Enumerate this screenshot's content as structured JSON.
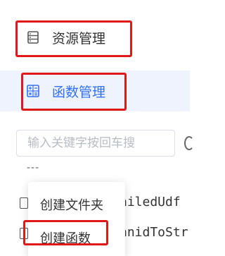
{
  "nav": {
    "resources": {
      "label": "资源管理",
      "icon": "list-doc-icon"
    },
    "functions": {
      "label": "函数管理",
      "icon": "function-calc-icon",
      "active": true
    }
  },
  "search": {
    "placeholder": "输入关键字按回车搜"
  },
  "tree": {
    "ellipsis": "---",
    "rows": [
      {
        "label": "ailedUdf"
      },
      {
        "label": "anidToStr"
      }
    ]
  },
  "context_menu": {
    "items": [
      {
        "label": "创建文件夹"
      },
      {
        "label": "创建函数"
      }
    ]
  },
  "colors": {
    "accent": "#3370ff",
    "active_bg": "#eef3fd",
    "highlight": "#e11818"
  }
}
